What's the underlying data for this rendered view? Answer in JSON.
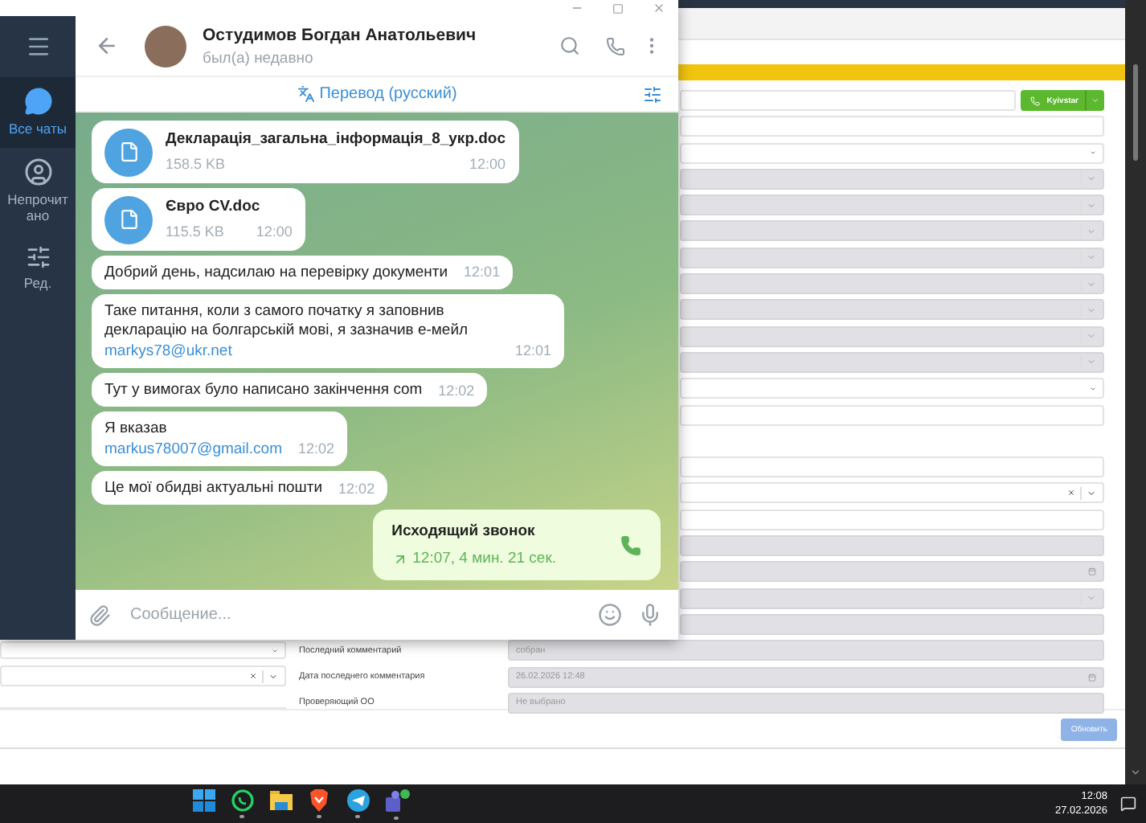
{
  "telegram": {
    "sidebar": [
      {
        "kind": "chats",
        "label": "Все чаты",
        "selected": true
      },
      {
        "kind": "unread",
        "label": "Непрочитано",
        "selected": false
      },
      {
        "kind": "edit",
        "label": "Ред.",
        "selected": false
      }
    ],
    "chat": {
      "name": "Остудимов Богдан Анатольевич",
      "status": "был(а) недавно"
    },
    "translate_bar": {
      "label": "Перевод (русский)"
    },
    "messages": [
      {
        "kind": "file",
        "outgoing": false,
        "name": "Декларація_загальна_інформація_8_укр.doc",
        "size": "158.5 KB",
        "time": "12:00"
      },
      {
        "kind": "file",
        "outgoing": false,
        "name": "Євро CV.doc",
        "size": "115.5 KB",
        "time": "12:00"
      },
      {
        "kind": "text",
        "outgoing": false,
        "text": "Добрий день, надсилаю на перевірку документи",
        "time": "12:01"
      },
      {
        "kind": "text",
        "outgoing": false,
        "text": "Таке питання, коли з самого початку я заповнив декларацію на болгарській мові, я зазначив е-мейл",
        "link": "markys78@ukr.net",
        "time": "12:01"
      },
      {
        "kind": "text",
        "outgoing": false,
        "text": "Тут у вимогах було написано закінчення com",
        "time": "12:02"
      },
      {
        "kind": "text",
        "outgoing": false,
        "text": "Я вказав",
        "link": "markus78007@gmail.com",
        "time": "12:02"
      },
      {
        "kind": "text",
        "outgoing": false,
        "text": "Це мої обидві актуальні пошти",
        "time": "12:02"
      },
      {
        "kind": "call",
        "outgoing": true,
        "title": "Исходящий звонок",
        "detail": "12:07, 4 мин. 21 сек."
      }
    ],
    "composer": {
      "placeholder": "Сообщение..."
    }
  },
  "crm": {
    "call_button": {
      "label": "Kyivstar"
    },
    "fields": [
      {
        "kind": "text-call",
        "disabled": false
      },
      {
        "kind": "text",
        "disabled": false
      },
      {
        "kind": "native-select",
        "disabled": false
      },
      {
        "kind": "select",
        "disabled": true
      },
      {
        "kind": "select",
        "disabled": true
      },
      {
        "kind": "select",
        "disabled": true
      },
      {
        "kind": "select",
        "disabled": true
      },
      {
        "kind": "select",
        "disabled": true
      },
      {
        "kind": "select",
        "disabled": true
      },
      {
        "kind": "select",
        "disabled": true
      },
      {
        "kind": "select",
        "disabled": true
      },
      {
        "kind": "native-select",
        "disabled": false
      },
      {
        "kind": "text",
        "disabled": false
      },
      {
        "kind": "spacer"
      },
      {
        "kind": "text",
        "disabled": false
      },
      {
        "kind": "clearable",
        "disabled": false
      },
      {
        "kind": "text",
        "disabled": false
      },
      {
        "kind": "text",
        "disabled": true
      },
      {
        "kind": "date",
        "disabled": true
      },
      {
        "kind": "select",
        "disabled": true
      },
      {
        "kind": "text",
        "disabled": true
      },
      {
        "kind": "text",
        "disabled": true,
        "label": "Последний комментарий",
        "value": "собран"
      },
      {
        "kind": "date",
        "disabled": true,
        "label": "Дата последнего комментария",
        "value": "26.02.2026 12:48"
      },
      {
        "kind": "text",
        "disabled": true,
        "label": "Проверяющий ОО",
        "value": "Не выбрано"
      }
    ],
    "side_fields": [
      {
        "kind": "native-select"
      },
      {
        "kind": "clearable"
      }
    ],
    "update_button": "Обновить"
  },
  "taskbar": {
    "apps": [
      {
        "kind": "windows",
        "running": false
      },
      {
        "kind": "whatsapp",
        "running": true
      },
      {
        "kind": "folder",
        "running": false
      },
      {
        "kind": "brave",
        "running": true
      },
      {
        "kind": "telegram",
        "running": true
      },
      {
        "kind": "teams",
        "running": true
      }
    ],
    "time": "12:08",
    "date": "27.02.2026"
  }
}
